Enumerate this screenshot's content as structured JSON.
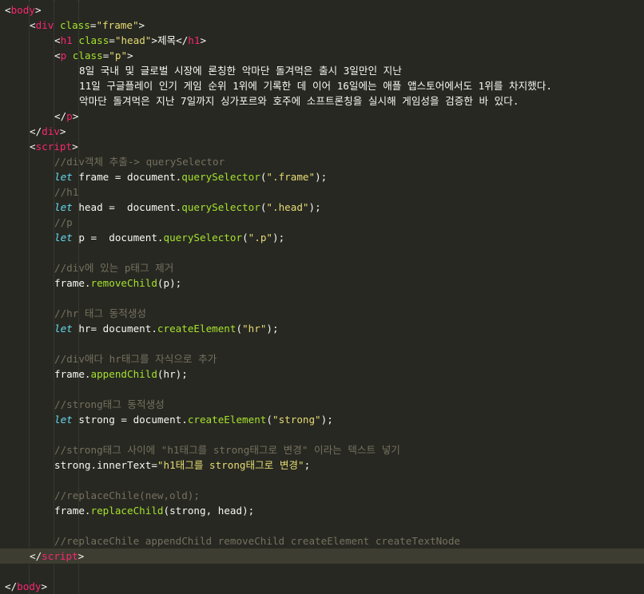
{
  "editor": {
    "theme_colors": {
      "background": "#272822",
      "current_line": "#3e3d32",
      "tag": "#f92672",
      "attribute": "#a6e22e",
      "string": "#e6db74",
      "keyword": "#66d9ef",
      "function": "#a6e22e",
      "comment": "#75715e",
      "plain": "#f8f8f2"
    },
    "lines": [
      {
        "indent": 0,
        "tokens": [
          [
            "pl",
            "<"
          ],
          [
            "tag",
            "body"
          ],
          [
            "pl",
            ">"
          ]
        ]
      },
      {
        "indent": 1,
        "tokens": [
          [
            "pl",
            "<"
          ],
          [
            "tag",
            "div"
          ],
          [
            "pl",
            " "
          ],
          [
            "attr",
            "class"
          ],
          [
            "pl",
            "="
          ],
          [
            "str",
            "\"frame\""
          ],
          [
            "pl",
            ">"
          ]
        ]
      },
      {
        "indent": 2,
        "tokens": [
          [
            "pl",
            "<"
          ],
          [
            "tag",
            "h1"
          ],
          [
            "pl",
            " "
          ],
          [
            "attr",
            "class"
          ],
          [
            "pl",
            "="
          ],
          [
            "str",
            "\"head\""
          ],
          [
            "pl",
            ">제목</"
          ],
          [
            "tag",
            "h1"
          ],
          [
            "pl",
            ">"
          ]
        ]
      },
      {
        "indent": 2,
        "tokens": [
          [
            "pl",
            "<"
          ],
          [
            "tag",
            "p"
          ],
          [
            "pl",
            " "
          ],
          [
            "attr",
            "class"
          ],
          [
            "pl",
            "="
          ],
          [
            "str",
            "\"p\""
          ],
          [
            "pl",
            ">"
          ]
        ]
      },
      {
        "indent": 3,
        "tokens": [
          [
            "txt",
            "8일 국내 및 글로벌 시장에 론칭한 악마단 돌겨먹은 출시 3일만인 지난"
          ]
        ]
      },
      {
        "indent": 3,
        "tokens": [
          [
            "txt",
            "11일 구글플레이 인기 게임 순위 1위에 기록한 데 이어 16일에는 애플 앱스토어에서도 1위를 차지했다."
          ]
        ]
      },
      {
        "indent": 3,
        "tokens": [
          [
            "txt",
            "악마단 돌겨먹은 지난 7일까지 싱가포르와 호주에 소프트론칭을 실시해 게임성을 검증한 바 있다."
          ]
        ]
      },
      {
        "indent": 2,
        "tokens": [
          [
            "pl",
            "</"
          ],
          [
            "tag",
            "p"
          ],
          [
            "pl",
            ">"
          ]
        ]
      },
      {
        "indent": 1,
        "tokens": [
          [
            "pl",
            "</"
          ],
          [
            "tag",
            "div"
          ],
          [
            "pl",
            ">"
          ]
        ]
      },
      {
        "indent": 1,
        "tokens": [
          [
            "pl",
            "<"
          ],
          [
            "tag",
            "script"
          ],
          [
            "pl",
            ">"
          ]
        ]
      },
      {
        "indent": 2,
        "tokens": [
          [
            "cm",
            "//div객체 추출-> querySelector"
          ]
        ]
      },
      {
        "indent": 2,
        "tokens": [
          [
            "kw",
            "let"
          ],
          [
            "pl",
            " frame = document."
          ],
          [
            "fn",
            "querySelector"
          ],
          [
            "pl",
            "("
          ],
          [
            "str",
            "\".frame\""
          ],
          [
            "pl",
            ");"
          ]
        ]
      },
      {
        "indent": 2,
        "tokens": [
          [
            "cm",
            "//h1"
          ]
        ]
      },
      {
        "indent": 2,
        "tokens": [
          [
            "kw",
            "let"
          ],
          [
            "pl",
            " head =  document."
          ],
          [
            "fn",
            "querySelector"
          ],
          [
            "pl",
            "("
          ],
          [
            "str",
            "\".head\""
          ],
          [
            "pl",
            ");"
          ]
        ]
      },
      {
        "indent": 2,
        "tokens": [
          [
            "cm",
            "//p"
          ]
        ]
      },
      {
        "indent": 2,
        "tokens": [
          [
            "kw",
            "let"
          ],
          [
            "pl",
            " p =  document."
          ],
          [
            "fn",
            "querySelector"
          ],
          [
            "pl",
            "("
          ],
          [
            "str",
            "\".p\""
          ],
          [
            "pl",
            ");"
          ]
        ]
      },
      {
        "indent": 0,
        "tokens": []
      },
      {
        "indent": 2,
        "tokens": [
          [
            "cm",
            "//div에 있는 p태그 제거"
          ]
        ]
      },
      {
        "indent": 2,
        "tokens": [
          [
            "pl",
            "frame."
          ],
          [
            "fn",
            "removeChild"
          ],
          [
            "pl",
            "(p);"
          ]
        ]
      },
      {
        "indent": 0,
        "tokens": []
      },
      {
        "indent": 2,
        "tokens": [
          [
            "cm",
            "//hr 태그 동적생성"
          ]
        ]
      },
      {
        "indent": 2,
        "tokens": [
          [
            "kw",
            "let"
          ],
          [
            "pl",
            " hr= document."
          ],
          [
            "fn",
            "createElement"
          ],
          [
            "pl",
            "("
          ],
          [
            "str",
            "\"hr\""
          ],
          [
            "pl",
            ");"
          ]
        ]
      },
      {
        "indent": 0,
        "tokens": []
      },
      {
        "indent": 2,
        "tokens": [
          [
            "cm",
            "//div애다 hr태그를 자식으로 추가"
          ]
        ]
      },
      {
        "indent": 2,
        "tokens": [
          [
            "pl",
            "frame."
          ],
          [
            "fn",
            "appendChild"
          ],
          [
            "pl",
            "(hr);"
          ]
        ]
      },
      {
        "indent": 0,
        "tokens": []
      },
      {
        "indent": 2,
        "tokens": [
          [
            "cm",
            "//strong태그 동적생성"
          ]
        ]
      },
      {
        "indent": 2,
        "tokens": [
          [
            "kw",
            "let"
          ],
          [
            "pl",
            " strong = document."
          ],
          [
            "fn",
            "createElement"
          ],
          [
            "pl",
            "("
          ],
          [
            "str",
            "\"strong\""
          ],
          [
            "pl",
            ");"
          ]
        ]
      },
      {
        "indent": 0,
        "tokens": []
      },
      {
        "indent": 2,
        "tokens": [
          [
            "cm",
            "//strong태그 사이에 \"h1태그를 strong태그로 변경\" 이라는 텍스트 넣기"
          ]
        ]
      },
      {
        "indent": 2,
        "tokens": [
          [
            "pl",
            "strong.innerText="
          ],
          [
            "str",
            "\"h1태그를 strong태그로 변경\""
          ],
          [
            "pl",
            ";"
          ]
        ]
      },
      {
        "indent": 0,
        "tokens": []
      },
      {
        "indent": 2,
        "tokens": [
          [
            "cm",
            "//replaceChile(new,old);"
          ]
        ]
      },
      {
        "indent": 2,
        "tokens": [
          [
            "pl",
            "frame."
          ],
          [
            "fn",
            "replaceChild"
          ],
          [
            "pl",
            "(strong, head);"
          ]
        ]
      },
      {
        "indent": 0,
        "tokens": []
      },
      {
        "indent": 2,
        "tokens": [
          [
            "cm",
            "//replaceChile appendChild removeChild createElement createTextNode"
          ]
        ]
      },
      {
        "indent": 1,
        "current": true,
        "tokens": [
          [
            "pl",
            "</"
          ],
          [
            "tag",
            "script"
          ],
          [
            "pl",
            ">"
          ]
        ]
      },
      {
        "indent": 0,
        "tokens": []
      },
      {
        "indent": 0,
        "tokens": [
          [
            "pl",
            "</"
          ],
          [
            "tag",
            "body"
          ],
          [
            "pl",
            ">"
          ]
        ]
      }
    ]
  }
}
